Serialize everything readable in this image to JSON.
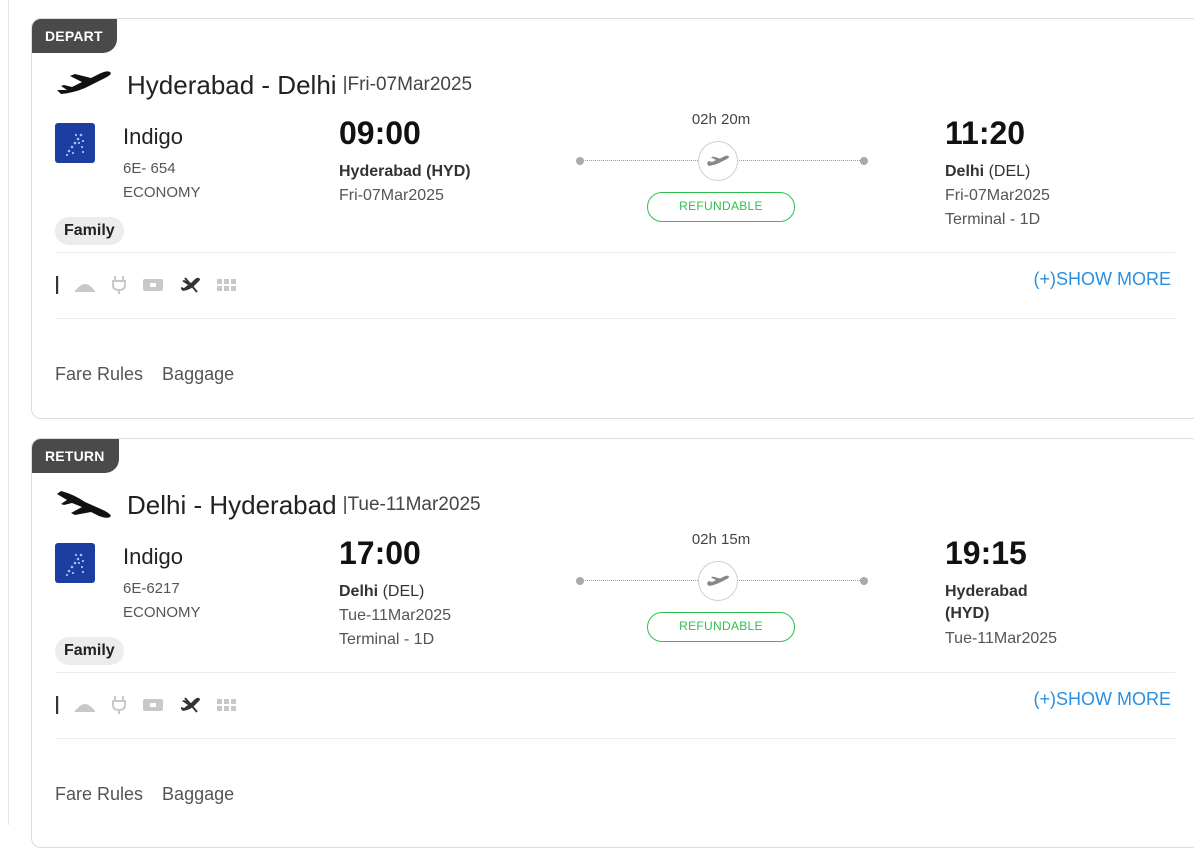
{
  "legs": [
    {
      "badge": "DEPART",
      "route": "Hyderabad - Delhi",
      "route_date": "|Fri-07Mar2025",
      "airline": "Indigo",
      "flight_no": "6E- 654",
      "cabin": "ECONOMY",
      "fare_type": "Family",
      "departure": {
        "time": "09:00",
        "city": "Hyderabad",
        "code": "(HYD)",
        "date": "Fri-07Mar2025",
        "terminal": ""
      },
      "duration": "02h 20m",
      "refund_status": "REFUNDABLE",
      "arrival": {
        "time": "11:20",
        "city": "Delhi",
        "code": "(DEL)",
        "date": "Fri-07Mar2025",
        "terminal": "Terminal - 1D"
      },
      "show_more": "(+)SHOW MORE",
      "links": {
        "fare_rules": "Fare Rules",
        "baggage": "Baggage"
      }
    },
    {
      "badge": "RETURN",
      "route": "Delhi - Hyderabad",
      "route_date": "|Tue-11Mar2025",
      "airline": "Indigo",
      "flight_no": "6E-6217",
      "cabin": "ECONOMY",
      "fare_type": "Family",
      "departure": {
        "time": "17:00",
        "city": "Delhi",
        "code": "(DEL)",
        "date": "Tue-11Mar2025",
        "terminal": "Terminal - 1D"
      },
      "duration": "02h 15m",
      "refund_status": "REFUNDABLE",
      "arrival": {
        "time": "19:15",
        "city": "Hyderabad",
        "code": "(HYD)",
        "date": "Tue-11Mar2025",
        "terminal": ""
      },
      "show_more": "(+)SHOW MORE",
      "links": {
        "fare_rules": "Fare Rules",
        "baggage": "Baggage"
      }
    }
  ],
  "amenity_icons": [
    "separator-icon",
    "meal-icon",
    "power-plug-icon",
    "entertainment-icon",
    "no-flight-icon",
    "seat-grid-icon"
  ],
  "colors": {
    "badge_bg": "#4a4a4a",
    "refundable": "#2fbf4f",
    "link": "#2a8fe0",
    "airline_logo": "#1c3ea0"
  }
}
